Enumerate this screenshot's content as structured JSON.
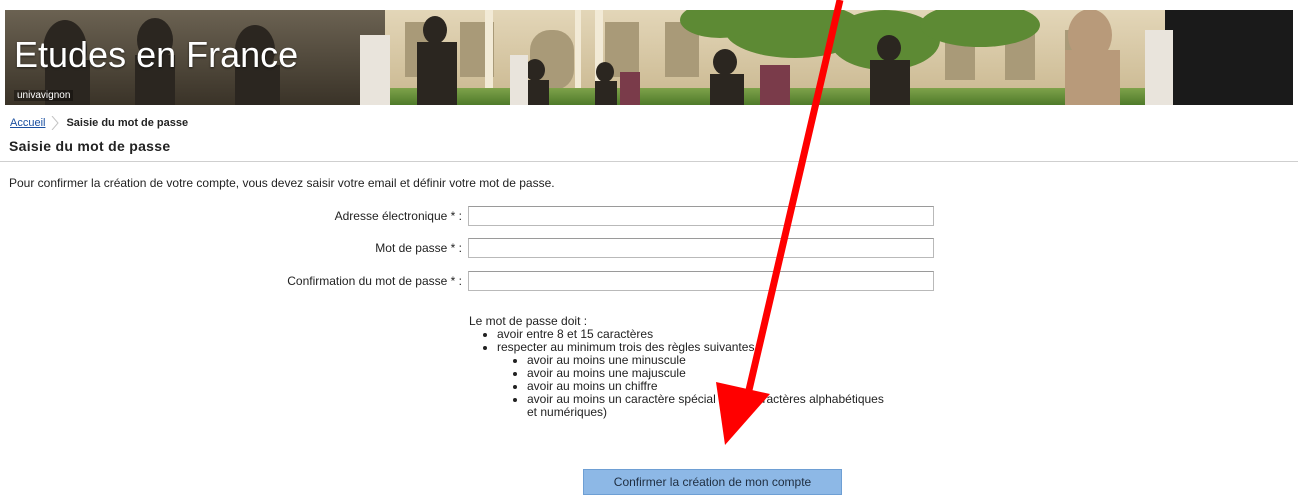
{
  "banner": {
    "title": "Etudes en France",
    "subtitle": "univavignon"
  },
  "breadcrumb": {
    "home": "Accueil",
    "current": "Saisie du mot de passe"
  },
  "page_title": "Saisie du mot de passe",
  "intro": "Pour confirmer la création de votre compte, vous devez saisir votre email et définir votre mot de passe.",
  "form": {
    "email_label": "Adresse électronique * :",
    "email_value": "",
    "password_label": "Mot de passe * :",
    "password_value": "",
    "confirm_label": "Confirmation du mot de passe * :",
    "confirm_value": ""
  },
  "rules": {
    "intro": "Le mot de passe doit :",
    "length": "avoir entre 8 et 15 caractères",
    "min_rules": "respecter au minimum trois des règles suivantes :",
    "lowercase": "avoir au moins une minuscule",
    "uppercase": "avoir au moins une majuscule",
    "digit": "avoir au moins un chiffre",
    "special": "avoir au moins un caractère spécial (hors caractères alphabétiques et numériques)"
  },
  "button": {
    "label": "Confirmer la création de mon compte"
  },
  "colors": {
    "button_bg": "#8db8e6",
    "link": "#1a4fa0",
    "arrow": "#ff0000"
  }
}
